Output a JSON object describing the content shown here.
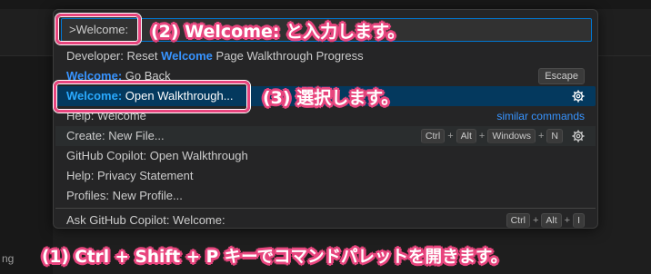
{
  "background": {
    "edge_text": "ng"
  },
  "palette": {
    "input_value": ">Welcome:",
    "items": [
      {
        "pre": "Developer: Reset ",
        "hl": "Welcome",
        "post": " Page Walkthrough Progress"
      },
      {
        "hl": "Welcome:",
        "post": " Go Back",
        "badge": "Escape"
      },
      {
        "hl": "Welcome:",
        "post": " Open Walkthrough..."
      },
      {
        "pre": "Help: Welcome",
        "link": "similar commands"
      },
      {
        "pre": "Create: New File...",
        "keys": [
          "Ctrl",
          "Alt",
          "Windows",
          "N"
        ]
      },
      {
        "pre": "GitHub Copilot: Open Walkthrough"
      },
      {
        "pre": "Help: Privacy Statement"
      },
      {
        "pre": "Profiles: New Profile..."
      },
      {
        "pre": "Ask GitHub Copilot: Welcome:",
        "keys": [
          "Ctrl",
          "Alt",
          "I"
        ]
      }
    ],
    "plus": "+"
  },
  "annotations": {
    "step1": "(1) Ctrl + Shift + P キーでコマンドパレットを開きます。",
    "step2": "(2) Welcome: と入力します。",
    "step3": "(3) 選択します。"
  },
  "colors": {
    "annotation": "#e8457e",
    "highlight": "#3794ff",
    "selected_bg": "#04395e"
  }
}
